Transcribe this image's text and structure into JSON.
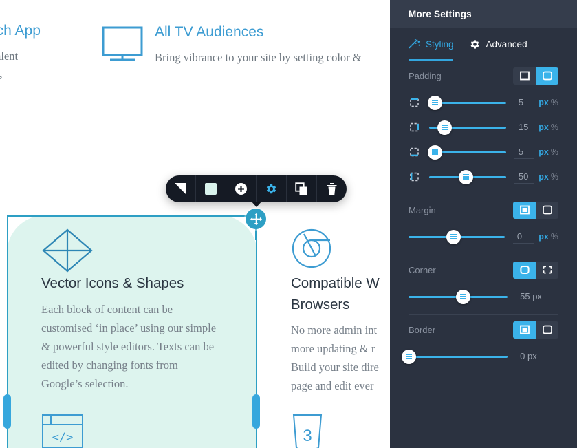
{
  "canvas": {
    "top_left_block": {
      "title": "watch App",
      "body": "gner talent\ng skills\nry."
    },
    "top_right_block": {
      "icon": "tv-monitor-icon",
      "title": "All TV Audiences",
      "body": "Bring vibrance to your site by setting color &"
    },
    "cards": [
      {
        "icon": "diamond-vector-icon",
        "title": "Vector Icons & Shapes",
        "body": "Each block of content can be customised ‘in place’ using our simple & powerful style editors. Texts can be edited by changing fonts from Google’s selection.",
        "bottom_icon": "code-window-icon",
        "selected": true
      },
      {
        "icon": "chrome-browser-icon",
        "title": "Compatible W\nBrowsers",
        "body": "No more admin int\nmore updating & r\nBuild your site dire\npage and edit ever",
        "bottom_icon": "css3-icon",
        "selected": false
      }
    ],
    "toolbar": {
      "buttons": [
        {
          "name": "background-split-button",
          "icon": "split-square-icon",
          "active": false
        },
        {
          "name": "fill-color-button",
          "icon": "filled-square-icon",
          "active": false
        },
        {
          "name": "add-block-button",
          "icon": "plus-circle-icon",
          "active": false
        },
        {
          "name": "settings-button",
          "icon": "gear-icon",
          "active": true
        },
        {
          "name": "duplicate-button",
          "icon": "copy-icon",
          "active": false
        },
        {
          "name": "delete-button",
          "icon": "trash-icon",
          "active": false
        }
      ]
    },
    "handles": {
      "move": "move-arrows-icon",
      "resize_left": "resize-handle",
      "resize_right": "resize-handle"
    }
  },
  "panel": {
    "title": "More Settings",
    "tabs": [
      {
        "label": "Styling",
        "icon": "magic-wand-icon",
        "active": true
      },
      {
        "label": "Advanced",
        "icon": "gear-icon",
        "active": false
      }
    ],
    "padding": {
      "label": "Padding",
      "mode_all": false,
      "mode_individual": true,
      "rows": [
        {
          "side": "top",
          "icon": "padding-top-icon",
          "value": "5",
          "pct": 8,
          "unit_px": "px",
          "unit_pct": "%"
        },
        {
          "side": "right",
          "icon": "padding-right-icon",
          "value": "15",
          "pct": 20,
          "unit_px": "px",
          "unit_pct": "%"
        },
        {
          "side": "bottom",
          "icon": "padding-bottom-icon",
          "value": "5",
          "pct": 8,
          "unit_px": "px",
          "unit_pct": "%"
        },
        {
          "side": "left",
          "icon": "padding-left-icon",
          "value": "50",
          "pct": 48,
          "unit_px": "px",
          "unit_pct": "%"
        }
      ]
    },
    "margin": {
      "label": "Margin",
      "mode_all": true,
      "mode_individual": false,
      "value": "0",
      "pct": 47,
      "unit_px": "px",
      "unit_pct": "%"
    },
    "corner": {
      "label": "Corner",
      "mode_all": true,
      "mode_individual": false,
      "value": "55 px",
      "pct": 55
    },
    "border": {
      "label": "Border",
      "mode_all": true,
      "mode_individual": false,
      "value": "0 px",
      "pct": 0
    },
    "colors": {
      "accent": "#33a6df",
      "panel_bg": "#2b3240",
      "header_bg": "#353d4c",
      "slider": "#3bb3ea"
    }
  }
}
